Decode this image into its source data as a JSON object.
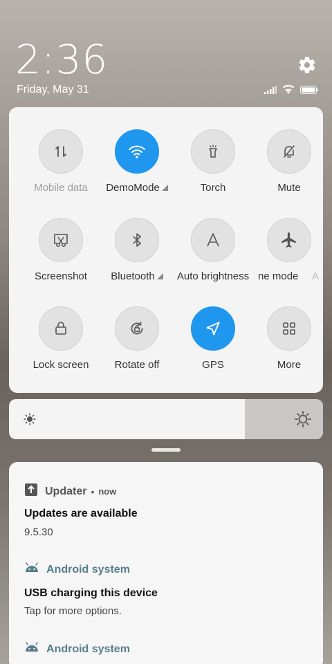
{
  "status": {
    "time": "2:36",
    "date": "Friday, May 31"
  },
  "quick_settings": {
    "tiles": [
      {
        "label": "Mobile data",
        "icon": "mobile-data-icon"
      },
      {
        "label": "DemoMode",
        "icon": "wifi-icon"
      },
      {
        "label": "Torch",
        "icon": "torch-icon"
      },
      {
        "label": "Mute",
        "icon": "mute-icon"
      },
      {
        "label": "Screenshot",
        "icon": "screenshot-icon"
      },
      {
        "label": "Bluetooth",
        "icon": "bluetooth-icon"
      },
      {
        "label": "Auto brightness",
        "icon": "auto-brightness-icon"
      },
      {
        "label": "ne mode",
        "icon": "airplane-icon"
      },
      {
        "label": "Lock screen",
        "icon": "lock-icon"
      },
      {
        "label": "Rotate off",
        "icon": "rotate-icon"
      },
      {
        "label": "GPS",
        "icon": "gps-icon"
      },
      {
        "label": "More",
        "icon": "more-grid-icon"
      }
    ],
    "overflow_label": "A"
  },
  "brightness": {
    "level": 0.75
  },
  "notifications": [
    {
      "app": "Updater",
      "time": "now",
      "title": "Updates are available",
      "body": "9.5.30"
    },
    {
      "app": "Android system",
      "title": "USB charging this device",
      "body": "Tap for more options."
    },
    {
      "app": "Android system"
    }
  ],
  "colors": {
    "accent": "#1f97ef",
    "app_teal": "#577d8c"
  }
}
